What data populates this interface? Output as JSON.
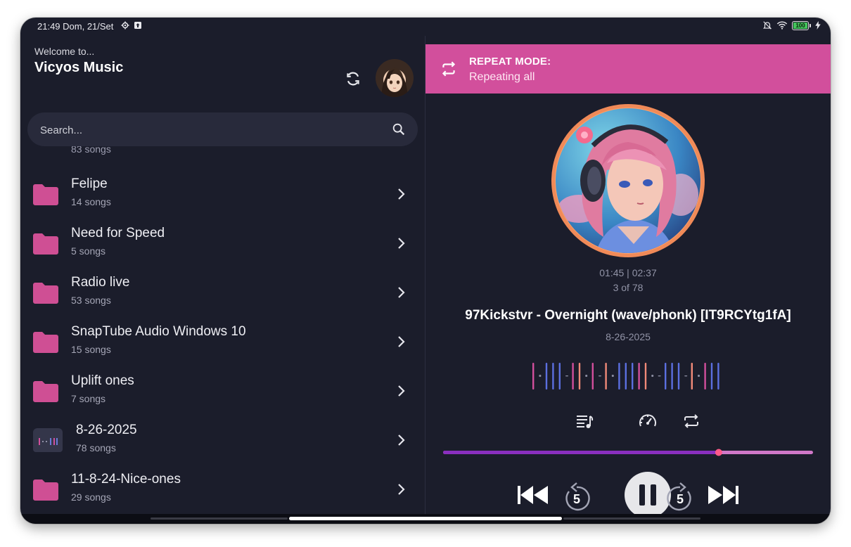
{
  "status_bar": {
    "time_date": "21:49 Dom, 21/Set",
    "battery": "100",
    "battery_level": 1.0
  },
  "header": {
    "welcome": "Welcome to...",
    "title": "Vicyos Music"
  },
  "search": {
    "placeholder": "Search..."
  },
  "folders": {
    "partial_count": "83 songs",
    "items": [
      {
        "name": "Felipe",
        "count": "14 songs"
      },
      {
        "name": "Need for Speed",
        "count": "5 songs"
      },
      {
        "name": "Radio live",
        "count": "53 songs"
      },
      {
        "name": "SnapTube Audio Windows 10",
        "count": "15 songs"
      },
      {
        "name": "Uplift ones",
        "count": "7 songs"
      },
      {
        "name": "8-26-2025",
        "count": "78 songs"
      },
      {
        "name": "11-8-24-Nice-ones",
        "count": "29 songs"
      }
    ]
  },
  "toast": {
    "title": "REPEAT MODE:",
    "text": "Repeating all"
  },
  "player": {
    "time": "01:45 | 02:37",
    "position": "3 of 78",
    "title": "97Kickstvr - Overnight (wave/phonk) [IT9RCYtg1fA]",
    "date": "8-26-2025",
    "progress": 0.745
  },
  "colors": {
    "background": "#1b1d2b",
    "accent_pink": "#d24f9c",
    "folder": "#cf4f94",
    "progress": "#8a2fbf",
    "progress_track": "#d078c8",
    "thumb": "#ff5a8a"
  }
}
